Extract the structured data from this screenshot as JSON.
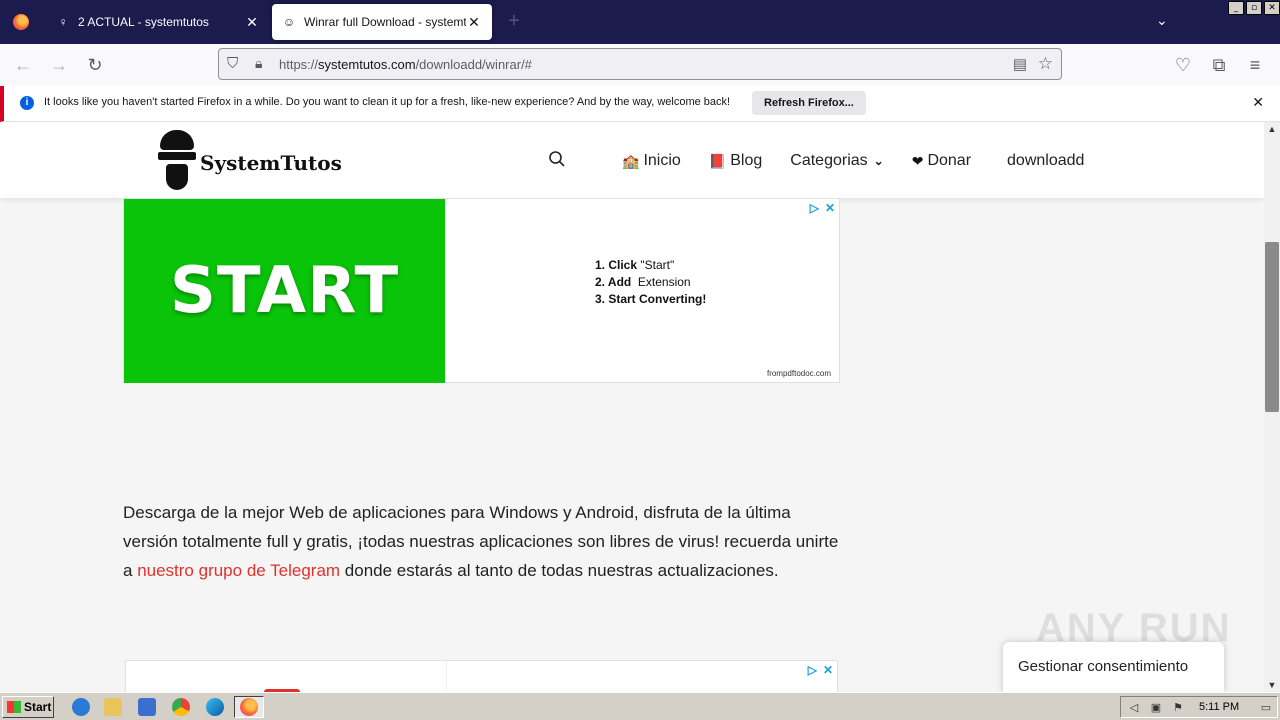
{
  "browser": {
    "tabs": [
      {
        "title": "2 ACTUAL - systemtutos",
        "active": false
      },
      {
        "title": "Winrar full Download - systemtutos",
        "active": true
      }
    ],
    "url_prefix": "https://",
    "url_domain": "systemtutos.com",
    "url_path": "/downloadd/winrar/#",
    "notification": {
      "message": "It looks like you haven't started Firefox in a while. Do you want to clean it up for a fresh, like-new experience? And by the way, welcome back!",
      "button": "Refresh Firefox..."
    }
  },
  "site": {
    "logo_text": "SystemTutos",
    "menu": [
      {
        "label": "Inicio",
        "icon": "🏫"
      },
      {
        "label": "Blog",
        "icon": "📕"
      },
      {
        "label": "Categorias",
        "icon": ""
      },
      {
        "label": "Donar",
        "icon": "❤"
      },
      {
        "label": "downloadd",
        "icon": ""
      }
    ],
    "ad": {
      "banner_text": "START",
      "step1_bold": "1. Click",
      "step1_rest": "\"Start\"",
      "step2_bold": "2. Add",
      "step2_rest": "Extension",
      "step3_bold": "3. Start Converting!",
      "source": "frompdftodoc.com"
    },
    "article": {
      "text_before": "Descarga de la mejor Web de aplicaciones para Windows y Android, disfruta de la última versión totalmente full y gratis, ¡todas nuestras aplicaciones son libres de virus! recuerda unirte a ",
      "link": "nuestro grupo de Telegram",
      "text_after": " donde estarás al tanto de todas nuestras actualizaciones."
    },
    "consent_button": "Gestionar consentimiento",
    "watermark": "ANY RUN"
  },
  "taskbar": {
    "start_label": "Start",
    "clock": "5:11 PM"
  }
}
